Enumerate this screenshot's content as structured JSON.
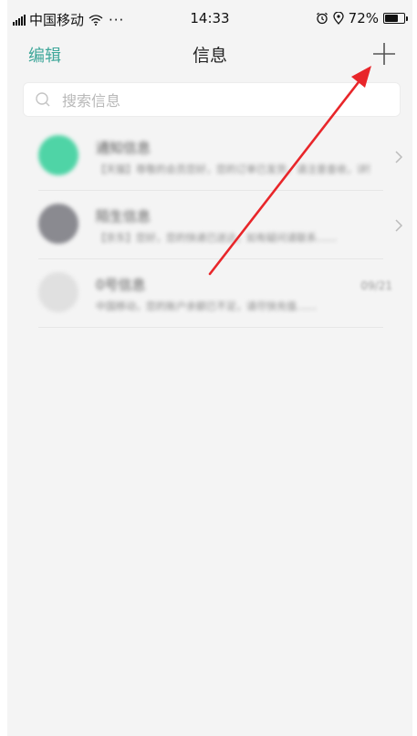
{
  "status_bar": {
    "carrier": "中国移动",
    "dots": "···",
    "time": "14:33",
    "battery": "72%",
    "battery_level": 0.72,
    "icons": [
      "signal-icon",
      "wifi-icon",
      "alarm-icon",
      "location-icon",
      "battery-icon"
    ]
  },
  "nav": {
    "edit_label": "编辑",
    "title": "信息",
    "add_icon": "plus-icon"
  },
  "search": {
    "placeholder": "搜索信息",
    "icon": "search-icon"
  },
  "conversations": [
    {
      "name": "通知信息",
      "preview": "【天猫】尊敬的会员您好，您的订单已发货，请注意查收，详情……",
      "date": "",
      "avatar_color": "#4fd4a6",
      "chevron": true
    },
    {
      "name": "陌生信息",
      "preview": "【京东】您好，您的快递已送达，如有疑问请联系……",
      "date": "",
      "avatar_color": "#8a8a90",
      "chevron": true
    },
    {
      "name": "0号信息",
      "preview": "中国移动，您的账户余额已不足，请尽快充值……",
      "date": "09/21",
      "avatar_color": "#e0e0e0",
      "chevron": false
    }
  ],
  "colors": {
    "accent": "#3fa79a",
    "background": "#f4f4f4",
    "arrow": "#e8262a"
  }
}
